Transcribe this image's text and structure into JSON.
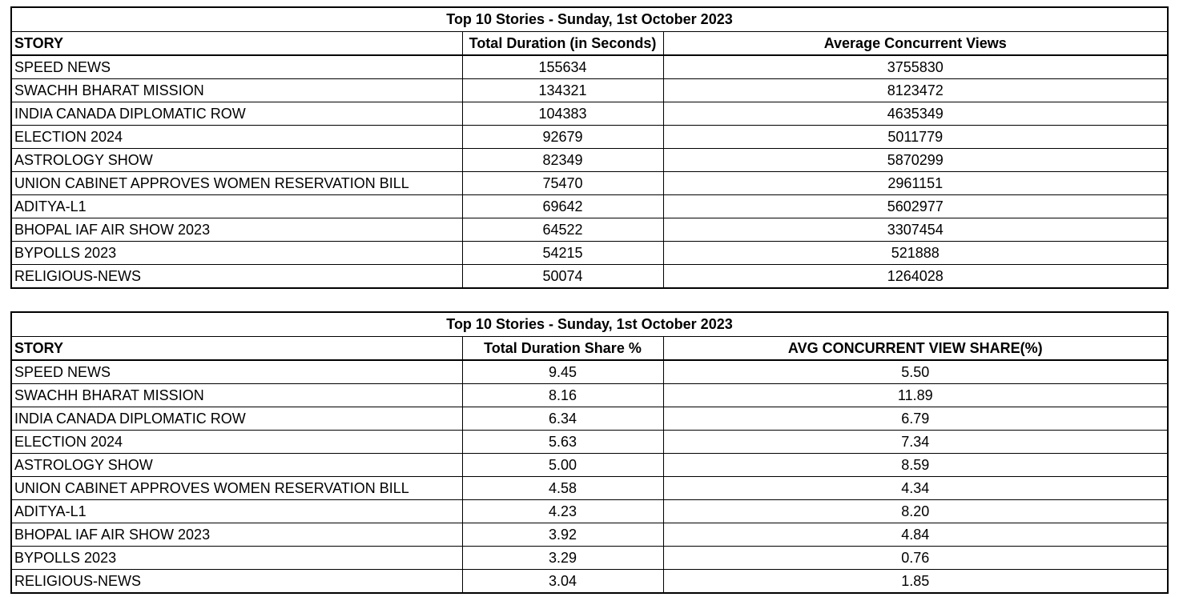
{
  "table1": {
    "title": "Top 10 Stories - Sunday, 1st October 2023",
    "headers": [
      "STORY",
      "Total Duration (in Seconds)",
      "Average Concurrent Views"
    ],
    "rows": [
      [
        "SPEED NEWS",
        "155634",
        "3755830"
      ],
      [
        "SWACHH BHARAT MISSION",
        "134321",
        "8123472"
      ],
      [
        "INDIA CANADA DIPLOMATIC ROW",
        "104383",
        "4635349"
      ],
      [
        "ELECTION 2024",
        "92679",
        "5011779"
      ],
      [
        "ASTROLOGY SHOW",
        "82349",
        "5870299"
      ],
      [
        "UNION CABINET APPROVES WOMEN RESERVATION BILL",
        "75470",
        "2961151"
      ],
      [
        "ADITYA-L1",
        "69642",
        "5602977"
      ],
      [
        "BHOPAL IAF AIR SHOW 2023",
        "64522",
        "3307454"
      ],
      [
        "BYPOLLS 2023",
        "54215",
        "521888"
      ],
      [
        "RELIGIOUS-NEWS",
        "50074",
        "1264028"
      ]
    ]
  },
  "table2": {
    "title": "Top 10 Stories - Sunday, 1st October 2023",
    "headers": [
      "STORY",
      "Total Duration Share %",
      "AVG CONCURRENT VIEW SHARE(%)"
    ],
    "rows": [
      [
        "SPEED NEWS",
        "9.45",
        "5.50"
      ],
      [
        "SWACHH BHARAT MISSION",
        "8.16",
        "11.89"
      ],
      [
        "INDIA CANADA DIPLOMATIC ROW",
        "6.34",
        "6.79"
      ],
      [
        "ELECTION 2024",
        "5.63",
        "7.34"
      ],
      [
        "ASTROLOGY SHOW",
        "5.00",
        "8.59"
      ],
      [
        "UNION CABINET APPROVES WOMEN RESERVATION BILL",
        "4.58",
        "4.34"
      ],
      [
        "ADITYA-L1",
        "4.23",
        "8.20"
      ],
      [
        "BHOPAL IAF AIR SHOW 2023",
        "3.92",
        "4.84"
      ],
      [
        "BYPOLLS 2023",
        "3.29",
        "0.76"
      ],
      [
        "RELIGIOUS-NEWS",
        "3.04",
        "1.85"
      ]
    ]
  }
}
